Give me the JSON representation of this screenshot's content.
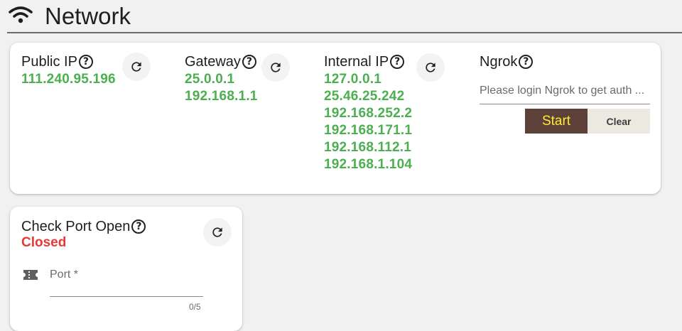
{
  "header": {
    "title": "Network",
    "icon": "wifi-icon"
  },
  "network": {
    "public_ip": {
      "label": "Public IP",
      "values": [
        "111.240.95.196"
      ]
    },
    "gateway": {
      "label": "Gateway",
      "values": [
        "25.0.0.1",
        "192.168.1.1"
      ]
    },
    "internal_ip": {
      "label": "Internal IP",
      "values": [
        "127.0.0.1",
        "25.46.25.242",
        "192.168.252.2",
        "192.168.171.1",
        "192.168.112.1",
        "192.168.1.104"
      ]
    },
    "ngrok": {
      "label": "Ngrok",
      "placeholder": "Please login Ngrok to get auth ...",
      "start_label": "Start",
      "clear_label": "Clear"
    }
  },
  "port_check": {
    "label": "Check Port Open",
    "status": "Closed",
    "field_label": "Port *",
    "counter": "0/5"
  },
  "colors": {
    "ip_green": "#4caf50",
    "closed_red": "#e53935",
    "start_bg": "#5d4037",
    "start_text": "#ffeb3b"
  }
}
